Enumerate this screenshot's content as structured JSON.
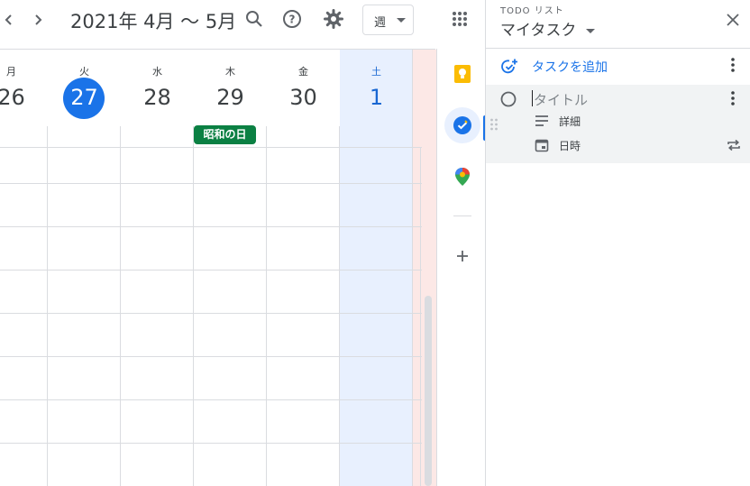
{
  "header": {
    "title": "2021年 4月 〜 5月",
    "view_label": "週",
    "prev_icon": "chevron-left-icon",
    "next_icon": "chevron-right-icon"
  },
  "days": [
    {
      "dow": "月",
      "num": "26"
    },
    {
      "dow": "火",
      "num": "27",
      "today": true
    },
    {
      "dow": "水",
      "num": "28"
    },
    {
      "dow": "木",
      "num": "29"
    },
    {
      "dow": "金",
      "num": "30"
    },
    {
      "dow": "土",
      "num": "1",
      "selected": true
    }
  ],
  "holiday": {
    "label": "昭和の日",
    "color": "#0b8043"
  },
  "colors": {
    "accent": "#1a73e8",
    "today_bg": "#1a73e8",
    "saturday_bg": "#e8f0fe",
    "sunday_bg": "#fce8e6"
  },
  "tasks_panel": {
    "eyebrow": "TODO リスト",
    "list_name": "マイタスク",
    "add_task_label": "タスクを追加",
    "new_task": {
      "title_placeholder": "タイトル",
      "details_label": "詳細",
      "datetime_label": "日時"
    }
  },
  "sidebar": {
    "apps": [
      "keep-icon",
      "tasks-icon",
      "maps-icon",
      "add-icon"
    ]
  }
}
